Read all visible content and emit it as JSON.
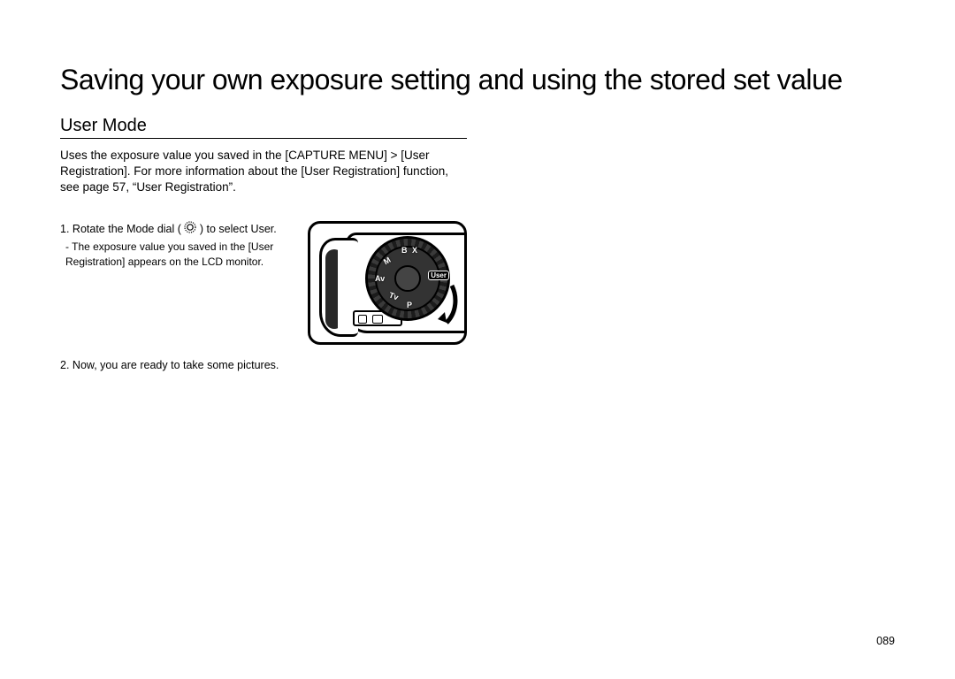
{
  "headline": "Saving your own exposure setting and using the stored set value",
  "section_title": "User Mode",
  "intro": "Uses the exposure value you saved in the [CAPTURE MENU] > [User Registration]. For more information about the [User Registration] function, see page 57, “User Registration”.",
  "steps": {
    "one": {
      "num": "1.",
      "main_a": "Rotate the Mode dial (",
      "main_b": ") to select User.",
      "sub": "- The exposure value you saved in the [User Registration] appears on the LCD monitor."
    },
    "two": {
      "num": "2.",
      "text": "Now, you are ready to take some pictures."
    }
  },
  "dial_labels": {
    "user": "User",
    "p": "P",
    "tv": "Tv",
    "av": "Av",
    "m": "M",
    "b": "B",
    "x": "X"
  },
  "page_number": "089"
}
